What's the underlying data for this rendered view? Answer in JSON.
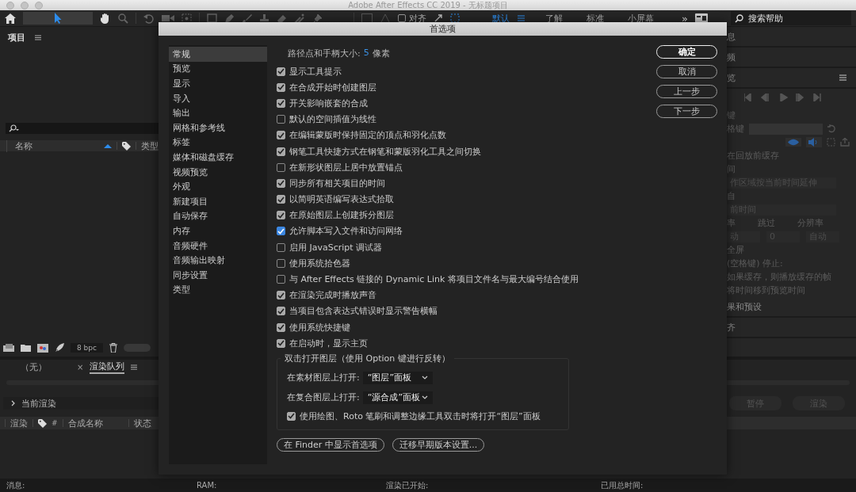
{
  "window": {
    "title": "Adobe After Effects CC 2019 - 无标题项目"
  },
  "toolbar": {
    "align": {
      "label": "对齐",
      "checked": false
    },
    "workspaces": [
      {
        "label": "默认",
        "selected": true
      },
      {
        "label": "了解",
        "selected": false
      },
      {
        "label": "标准",
        "selected": false
      },
      {
        "label": "小屏幕",
        "selected": false
      }
    ],
    "overflow": "»",
    "search": {
      "placeholder": "搜索帮助"
    }
  },
  "project_panel": {
    "title": "项目",
    "columns": [
      "名称",
      "类型"
    ],
    "bpc": "8 bpc",
    "thumbnail_slider": {
      "level": 1
    }
  },
  "right_panel": [
    {
      "kind": "section",
      "text": "息"
    },
    {
      "kind": "section",
      "text": "频"
    },
    {
      "kind": "menu_section",
      "text": "览"
    },
    {
      "kind": "transport"
    },
    {
      "kind": "text",
      "text": "键"
    },
    {
      "kind": "field",
      "text": "格键"
    },
    {
      "kind": "icons"
    },
    {
      "kind": "text",
      "text": "在回放前缓存"
    },
    {
      "kind": "text",
      "text": "间"
    },
    {
      "kind": "dropdown",
      "text": "作区域按当前时间延伸"
    },
    {
      "kind": "text",
      "text": "自"
    },
    {
      "kind": "dropdown",
      "text": "前时间"
    },
    {
      "kind": "triple_labels",
      "items": [
        "率",
        "跳过",
        "分辨率"
      ]
    },
    {
      "kind": "triple_dropdowns",
      "items": [
        "动",
        "0",
        "自动"
      ]
    },
    {
      "kind": "text",
      "text": "全屏"
    },
    {
      "kind": "text",
      "text": "(空格键) 停止:"
    },
    {
      "kind": "text",
      "text": "如果缓存，则播放缓存的帧"
    },
    {
      "kind": "text",
      "text": "将时间移到预览时间"
    },
    {
      "kind": "section",
      "text": "果和预设"
    },
    {
      "kind": "section",
      "text": "齐"
    }
  ],
  "render_panel": {
    "tabs": [
      {
        "label": "（无）",
        "selected": false
      },
      {
        "label": "渲染队列",
        "selected": true
      }
    ],
    "close": "×",
    "current_render": "当前渲染",
    "buttons": [
      "暂停",
      "渲染"
    ],
    "columns": [
      "渲染",
      "#",
      "合成名称",
      "状态"
    ]
  },
  "dialog": {
    "title": "首选项",
    "categories": [
      {
        "label": "常规",
        "selected": true
      },
      {
        "label": "预览",
        "selected": false
      },
      {
        "label": "显示",
        "selected": false
      },
      {
        "label": "导入",
        "selected": false
      },
      {
        "label": "输出",
        "selected": false
      },
      {
        "label": "网格和参考线",
        "selected": false
      },
      {
        "label": "标签",
        "selected": false
      },
      {
        "label": "媒体和磁盘缓存",
        "selected": false
      },
      {
        "label": "视频预览",
        "selected": false
      },
      {
        "label": "外观",
        "selected": false
      },
      {
        "label": "新建项目",
        "selected": false
      },
      {
        "label": "自动保存",
        "selected": false
      },
      {
        "label": "内存",
        "selected": false
      },
      {
        "label": "音频硬件",
        "selected": false
      },
      {
        "label": "音频输出映射",
        "selected": false
      },
      {
        "label": "同步设置",
        "selected": false
      },
      {
        "label": "类型",
        "selected": false
      }
    ],
    "handle_size": {
      "label": "路径点和手柄大小:",
      "value": "5",
      "unit": "像素"
    },
    "options": [
      {
        "label": "显示工具提示",
        "checked": true
      },
      {
        "label": "在合成开始时创建图层",
        "checked": true
      },
      {
        "label": "开关影响嵌套的合成",
        "checked": true
      },
      {
        "label": "默认的空间插值为线性",
        "checked": false
      },
      {
        "label": "在编辑蒙版时保持固定的顶点和羽化点数",
        "checked": true
      },
      {
        "label": "钢笔工具快捷方式在钢笔和蒙版羽化工具之间切换",
        "checked": true
      },
      {
        "label": "在新形状图层上居中放置锚点",
        "checked": false
      },
      {
        "label": "同步所有相关项目的时间",
        "checked": true
      },
      {
        "label": "以简明英语编写表达式拾取",
        "checked": true
      },
      {
        "label": "在原始图层上创建拆分图层",
        "checked": true
      },
      {
        "label": "允许脚本写入文件和访问网络",
        "checked": true,
        "focused": true
      },
      {
        "label": "启用 JavaScript 调试器",
        "checked": false
      },
      {
        "label": "使用系统拾色器",
        "checked": false
      },
      {
        "label": "与 After Effects 链接的 Dynamic Link 将项目文件名与最大编号结合使用",
        "checked": false
      },
      {
        "label": "在渲染完成时播放声音",
        "checked": true
      },
      {
        "label": "当项目包含表达式错误时显示警告横幅",
        "checked": true
      },
      {
        "label": "使用系统快捷键",
        "checked": true
      },
      {
        "label": "在启动时，显示主页",
        "checked": true
      }
    ],
    "double_click": {
      "title": "双击打开图层（使用 Option 键进行反转）",
      "selects": [
        {
          "label": "在素材图层上打开:",
          "value": "“图层”面板"
        },
        {
          "label": "在复合图层上打开:",
          "value": "“源合成”面板"
        }
      ],
      "option": {
        "label": "使用绘图、Roto 笔刷和调整边缘工具双击时将打开“图层”面板",
        "checked": true
      }
    },
    "footer_buttons": [
      "在 Finder 中显示首选项",
      "迁移早期版本设置..."
    ],
    "buttons": [
      {
        "label": "确定",
        "primary": true
      },
      {
        "label": "取消",
        "primary": false
      },
      {
        "label": "上一步",
        "primary": false
      },
      {
        "label": "下一步",
        "primary": false
      }
    ]
  },
  "status_bar": [
    "消息:",
    "RAM:",
    "渲染已开始:",
    "已用总时间:"
  ]
}
